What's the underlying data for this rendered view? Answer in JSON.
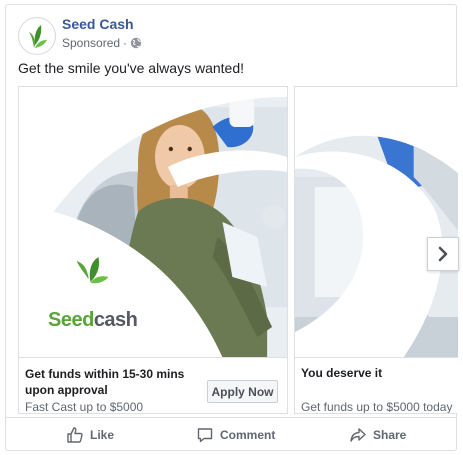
{
  "page": {
    "name": "Seed Cash",
    "sponsored": "Sponsored",
    "separator": "·",
    "post_text": "Get the smile you've always wanted!"
  },
  "brand": {
    "logo_seed": "Seed",
    "logo_cash": "cash",
    "green": "#5aa43a",
    "link_blue": "#385898"
  },
  "cards": [
    {
      "headline": "Get funds within 15-30 mins upon approval",
      "description": "Fast Cast up to $5000",
      "cta": "Apply Now"
    },
    {
      "headline": "You deserve it",
      "description": "Get funds up to $5000 today"
    }
  ],
  "actions": {
    "like": "Like",
    "comment": "Comment",
    "share": "Share"
  },
  "icons": [
    "globe-icon",
    "chevron-right-icon",
    "thumbs-up-icon",
    "comment-icon",
    "share-icon"
  ]
}
